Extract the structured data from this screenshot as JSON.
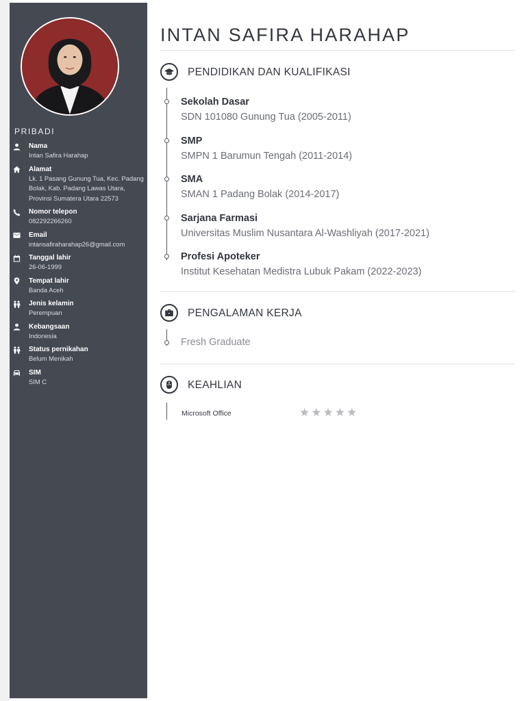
{
  "name": "INTAN SAFIRA HARAHAP",
  "sidebar": {
    "section_title": "PRIBADI",
    "items": [
      {
        "icon": "person-icon",
        "label": "Nama",
        "value": "Intan Safira Harahap"
      },
      {
        "icon": "home-icon",
        "label": "Alamat",
        "value": "Lk. 1 Pasang Gunung Tua, Kec. Padang Bolak, Kab. Padang Lawas Utara, Provinsi Sumatera Utara 22573"
      },
      {
        "icon": "phone-icon",
        "label": "Nomor telepon",
        "value": "082292266260"
      },
      {
        "icon": "email-icon",
        "label": "Email",
        "value": "intansafiraharahap26@gmail.com"
      },
      {
        "icon": "calendar-icon",
        "label": "Tanggal lahir",
        "value": "26-06-1999"
      },
      {
        "icon": "location-pin-icon",
        "label": "Tempat lahir",
        "value": "Banda Aceh"
      },
      {
        "icon": "people-icon",
        "label": "Jenis kelamin",
        "value": "Perempuan"
      },
      {
        "icon": "person-icon",
        "label": "Kebangsaan",
        "value": "Indonesia"
      },
      {
        "icon": "people-icon",
        "label": "Status pernikahan",
        "value": "Belum Menikah"
      },
      {
        "icon": "car-icon",
        "label": "SIM",
        "value": "SIM C"
      }
    ]
  },
  "education": {
    "title": "PENDIDIKAN DAN KUALIFIKASI",
    "icon": "graduation-cap-icon",
    "items": [
      {
        "degree": "Sekolah Dasar",
        "school": "SDN 101080 Gunung Tua (2005-2011)"
      },
      {
        "degree": "SMP",
        "school": "SMPN 1 Barumun Tengah (2011-2014)"
      },
      {
        "degree": "SMA",
        "school": "SMAN 1 Padang Bolak (2014-2017)"
      },
      {
        "degree": "Sarjana Farmasi",
        "school": "Universitas Muslim Nusantara Al-Washliyah (2017-2021)"
      },
      {
        "degree": "Profesi Apoteker",
        "school": "Institut Kesehatan Medistra Lubuk Pakam (2022-2023)"
      }
    ]
  },
  "work": {
    "title": "PENGALAMAN KERJA",
    "icon": "briefcase-icon",
    "items": [
      "Fresh Graduate"
    ]
  },
  "skills": {
    "title": "KEAHLIAN",
    "icon": "mouse-icon",
    "items": [
      {
        "name": "Microsoft Office",
        "rating": 0,
        "max": 5
      }
    ]
  },
  "colors": {
    "sidebar_bg": "#454952",
    "photo_bg": "#8e2b2b",
    "heading": "#333640",
    "star_empty": "#b9bbbf"
  }
}
